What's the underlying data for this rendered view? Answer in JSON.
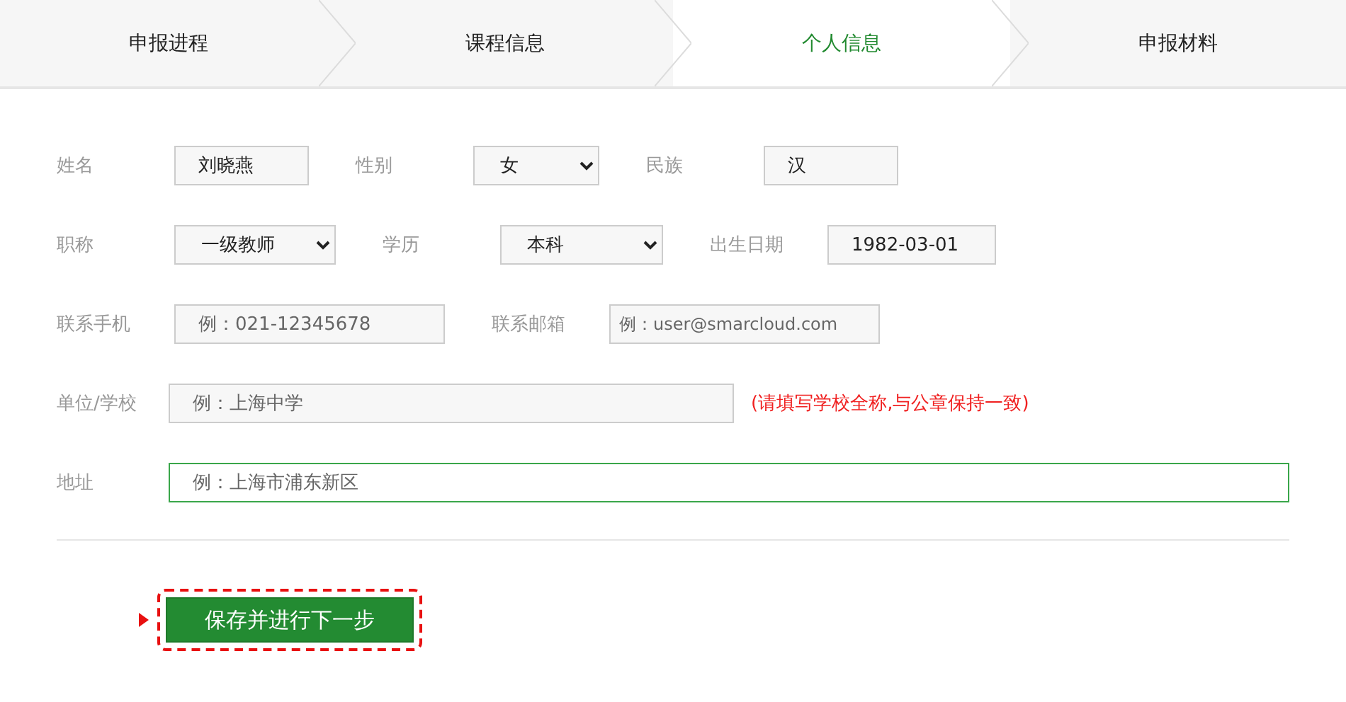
{
  "steps": [
    {
      "label": "申报进程",
      "selected": false
    },
    {
      "label": "课程信息",
      "selected": false
    },
    {
      "label": "个人信息",
      "selected": true
    },
    {
      "label": "申报材料",
      "selected": false
    }
  ],
  "form_rows": [
    {
      "fields": [
        {
          "label": "姓名",
          "kind": "input",
          "value": "刘晓燕",
          "focused": false
        },
        {
          "label": "性别",
          "kind": "select",
          "value": "女"
        },
        {
          "label": "民族",
          "kind": "input",
          "value": "汉",
          "focused": false
        }
      ]
    },
    {
      "fields": [
        {
          "label": "职称",
          "kind": "select",
          "value": "一级教师"
        },
        {
          "label": "学历",
          "kind": "select",
          "value": "本科"
        },
        {
          "label": "出生日期",
          "kind": "input",
          "value": "1982-03-01",
          "focused": false
        }
      ]
    },
    {
      "fields": [
        {
          "label": "联系手机",
          "kind": "input",
          "placeholder": "例：021-12345678",
          "focused": false
        },
        {
          "label": "联系邮箱",
          "kind": "input",
          "placeholder": "例：user@smarcloud.com",
          "focused": false
        }
      ]
    },
    {
      "fields": [
        {
          "label": "单位/学校",
          "kind": "input",
          "placeholder": "例：上海中学",
          "note": "(请填写学校全称,与公章保持一致)",
          "focused": false
        }
      ]
    },
    {
      "fields": [
        {
          "label": "地址",
          "kind": "input",
          "placeholder": "例：上海市浦东新区",
          "focused": true
        }
      ]
    }
  ],
  "submit_button": {
    "label": "保存并进行下一步",
    "highlighted": true
  }
}
